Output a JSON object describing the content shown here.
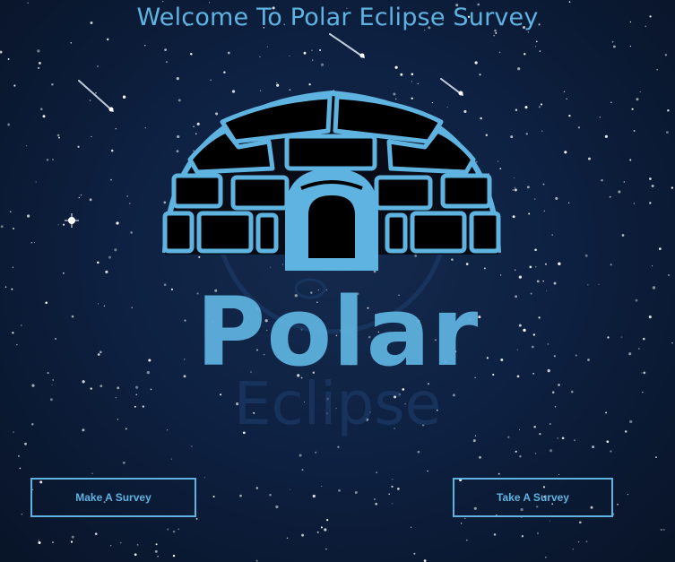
{
  "page": {
    "title": "Welcome To Polar Eclipse Survey"
  },
  "logo": {
    "icon": "igloo-icon",
    "brand_primary": "Polar",
    "brand_secondary": "Eclipse"
  },
  "actions": {
    "make_survey_label": "Make A Survey",
    "take_survey_label": "Take A Survey"
  },
  "colors": {
    "accent": "#5fb3e0",
    "background": "#0e2142",
    "logo_dark_circle": "#1a3863"
  }
}
